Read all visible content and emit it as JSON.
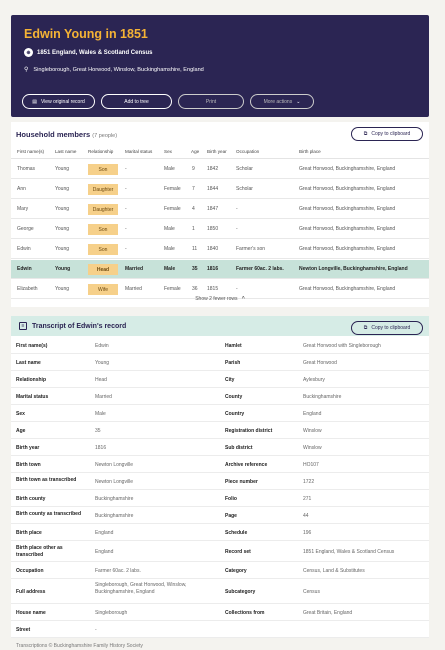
{
  "header": {
    "title": "Edwin Young in 1851",
    "source_icon": "census-icon",
    "source": "1851 England, Wales & Scotland Census",
    "location_icon": "pin-icon",
    "location": "Singleborough, Great Horwood, Winslow, Buckinghamshire, England",
    "buttons": {
      "view_original": "View original record",
      "add_to_tree": "Add to tree",
      "print": "Print",
      "more_actions": "More actions"
    }
  },
  "household": {
    "title": "Household members",
    "count": "(7 people)",
    "copy_label": "Copy to clipboard",
    "columns": [
      "First name(s)",
      "Last name",
      "Relationship",
      "Marital status",
      "Sex",
      "Age",
      "Birth year",
      "Occupation",
      "Birth place"
    ],
    "rows": [
      {
        "first": "Thomas",
        "last": "Young",
        "rel": "Son",
        "marital": "-",
        "sex": "Male",
        "age": "9",
        "year": "1842",
        "occ": "Scholar",
        "place": "Great Horwood, Buckinghamshire, England"
      },
      {
        "first": "Ann",
        "last": "Young",
        "rel": "Daughter",
        "marital": "-",
        "sex": "Female",
        "age": "7",
        "year": "1844",
        "occ": "Scholar",
        "place": "Great Horwood, Buckinghamshire, England"
      },
      {
        "first": "Mary",
        "last": "Young",
        "rel": "Daughter",
        "marital": "-",
        "sex": "Female",
        "age": "4",
        "year": "1847",
        "occ": "-",
        "place": "Great Horwood, Buckinghamshire, England"
      },
      {
        "first": "George",
        "last": "Young",
        "rel": "Son",
        "marital": "-",
        "sex": "Male",
        "age": "1",
        "year": "1850",
        "occ": "-",
        "place": "Great Horwood, Buckinghamshire, England"
      },
      {
        "first": "Edwin",
        "last": "Young",
        "rel": "Son",
        "marital": "-",
        "sex": "Male",
        "age": "11",
        "year": "1840",
        "occ": "Farmer's son",
        "place": "Great Horwood, Buckinghamshire, England"
      },
      {
        "first": "Edwin",
        "last": "Young",
        "rel": "Head",
        "marital": "Married",
        "sex": "Male",
        "age": "35",
        "year": "1816",
        "occ": "Farmer 60ac. 2 labs.",
        "place": "Newton Longville, Buckinghamshire, England"
      },
      {
        "first": "Elizabeth",
        "last": "Young",
        "rel": "Wife",
        "marital": "Married",
        "sex": "Female",
        "age": "36",
        "year": "1815",
        "occ": "-",
        "place": "Great Horwood, Buckinghamshire, England"
      }
    ],
    "fewer_label": "Show 2 fewer rows"
  },
  "transcript": {
    "title": "Transcript of Edwin's record",
    "copy_label": "Copy to clipboard",
    "rows": [
      {
        "l1": "First name(s)",
        "v1": "Edwin",
        "l2": "Hamlet",
        "v2": "Great Horwood with Singleborough"
      },
      {
        "l1": "Last name",
        "v1": "Young",
        "l2": "Parish",
        "v2": "Great Horwood"
      },
      {
        "l1": "Relationship",
        "v1": "Head",
        "l2": "City",
        "v2": "Aylesbury"
      },
      {
        "l1": "Marital status",
        "v1": "Married",
        "l2": "County",
        "v2": "Buckinghamshire"
      },
      {
        "l1": "Sex",
        "v1": "Male",
        "l2": "Country",
        "v2": "England"
      },
      {
        "l1": "Age",
        "v1": "35",
        "l2": "Registration district",
        "v2": "Winslow"
      },
      {
        "l1": "Birth year",
        "v1": "1816",
        "l2": "Sub district",
        "v2": "Winslow"
      },
      {
        "l1": "Birth town",
        "v1": "Newton Longville",
        "l2": "Archive reference",
        "v2": "HO107"
      },
      {
        "l1": "Birth town as transcribed",
        "v1": "Newton Longville",
        "l2": "Piece number",
        "v2": "1722"
      },
      {
        "l1": "Birth county",
        "v1": "Buckinghamshire",
        "l2": "Folio",
        "v2": "271"
      },
      {
        "l1": "Birth county as transcribed",
        "v1": "Buckinghamshire",
        "l2": "Page",
        "v2": "44"
      },
      {
        "l1": "Birth place",
        "v1": "England",
        "l2": "Schedule",
        "v2": "196"
      },
      {
        "l1": "Birth place other as transcribed",
        "v1": "England",
        "l2": "Record set",
        "v2": "1851 England, Wales & Scotland Census"
      },
      {
        "l1": "Occupation",
        "v1": "Farmer 60ac. 2 labs.",
        "l2": "Category",
        "v2": "Census, Land & Substitutes"
      },
      {
        "l1": "Full address",
        "v1": "Singleborough, Great Horwood, Winslow, Buckinghamshire, England",
        "l2": "Subcategory",
        "v2": "Census"
      },
      {
        "l1": "House name",
        "v1": "Singleborough",
        "l2": "Collections from",
        "v2": "Great Britain, England"
      },
      {
        "l1": "Street",
        "v1": "-",
        "l2": "",
        "v2": ""
      }
    ]
  },
  "footer": {
    "credit": "Transcriptions © Buckinghamshire Family History Society"
  }
}
